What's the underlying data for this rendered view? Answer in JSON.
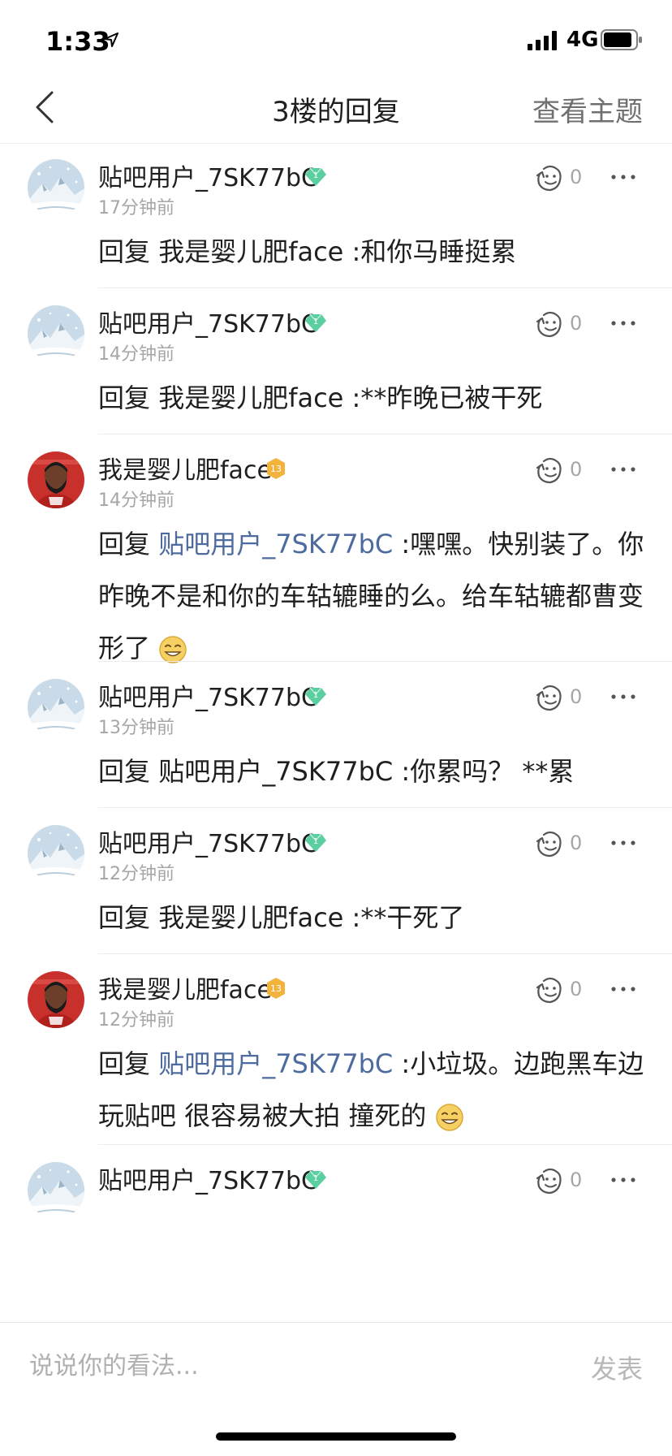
{
  "status": {
    "time": "1:33",
    "network": "4G"
  },
  "nav": {
    "title": "3楼的回复",
    "action": "查看主题"
  },
  "replies": [
    {
      "user": "贴吧用户_7SK77bC",
      "badge": "diamond",
      "time": "17分钟前",
      "likes": "0",
      "prefix": "回复 ",
      "target": "我是婴儿肥face",
      "target_is_link": false,
      "text": " :和你马睡挺累",
      "emoji": false
    },
    {
      "user": "贴吧用户_7SK77bC",
      "badge": "diamond",
      "time": "14分钟前",
      "likes": "0",
      "prefix": "回复 ",
      "target": "我是婴儿肥face",
      "target_is_link": false,
      "text": " :**昨晚已被干死",
      "emoji": false
    },
    {
      "user": "我是婴儿肥face",
      "badge": "13",
      "time": "14分钟前",
      "likes": "0",
      "prefix": "回复 ",
      "target": "贴吧用户_7SK77bC",
      "target_is_link": true,
      "text": " :嘿嘿。快别装了。你昨晚不是和你的车轱辘睡的么。给车轱辘都曹变形了",
      "emoji": true
    },
    {
      "user": "贴吧用户_7SK77bC",
      "badge": "diamond",
      "time": "13分钟前",
      "likes": "0",
      "prefix": "回复 ",
      "target": "贴吧用户_7SK77bC",
      "target_is_link": false,
      "text": " :你累吗？ **累",
      "emoji": false
    },
    {
      "user": "贴吧用户_7SK77bC",
      "badge": "diamond",
      "time": "12分钟前",
      "likes": "0",
      "prefix": "回复 ",
      "target": "我是婴儿肥face",
      "target_is_link": false,
      "text": " :**干死了",
      "emoji": false
    },
    {
      "user": "我是婴儿肥face",
      "badge": "13",
      "time": "12分钟前",
      "likes": "0",
      "prefix": "回复 ",
      "target": "贴吧用户_7SK77bC",
      "target_is_link": true,
      "text": " :小垃圾。边跑黑车边玩贴吧 很容易被大拍 撞死的",
      "emoji": true
    },
    {
      "user": "贴吧用户_7SK77bC",
      "badge": "diamond",
      "time": "",
      "likes": "0",
      "prefix": "",
      "target": "",
      "target_is_link": false,
      "text": "",
      "emoji": false
    }
  ],
  "composer": {
    "placeholder": "说说你的看法...",
    "submit": "发表"
  },
  "colors": {
    "link": "#4d6b9e",
    "diamond": "#5ccfa1",
    "level": "#f2b23c",
    "meta": "#a6a6a6"
  }
}
